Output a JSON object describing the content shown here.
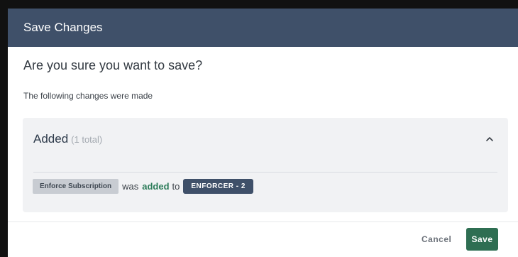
{
  "dialog": {
    "title": "Save Changes",
    "question": "Are you sure you want to save?",
    "subtext": "The following changes were made"
  },
  "panel": {
    "heading": "Added",
    "count_text": "(1 total)",
    "expanded": true,
    "change": {
      "field": "Enforce Subscription",
      "text_before": "was",
      "action": "added",
      "text_after": "to",
      "target": "ENFORCER - 2"
    }
  },
  "footer": {
    "cancel_label": "Cancel",
    "save_label": "Save"
  },
  "colors": {
    "header_bg": "#3f5069",
    "primary_button": "#2e6e52",
    "added_text": "#2e7d5b"
  }
}
